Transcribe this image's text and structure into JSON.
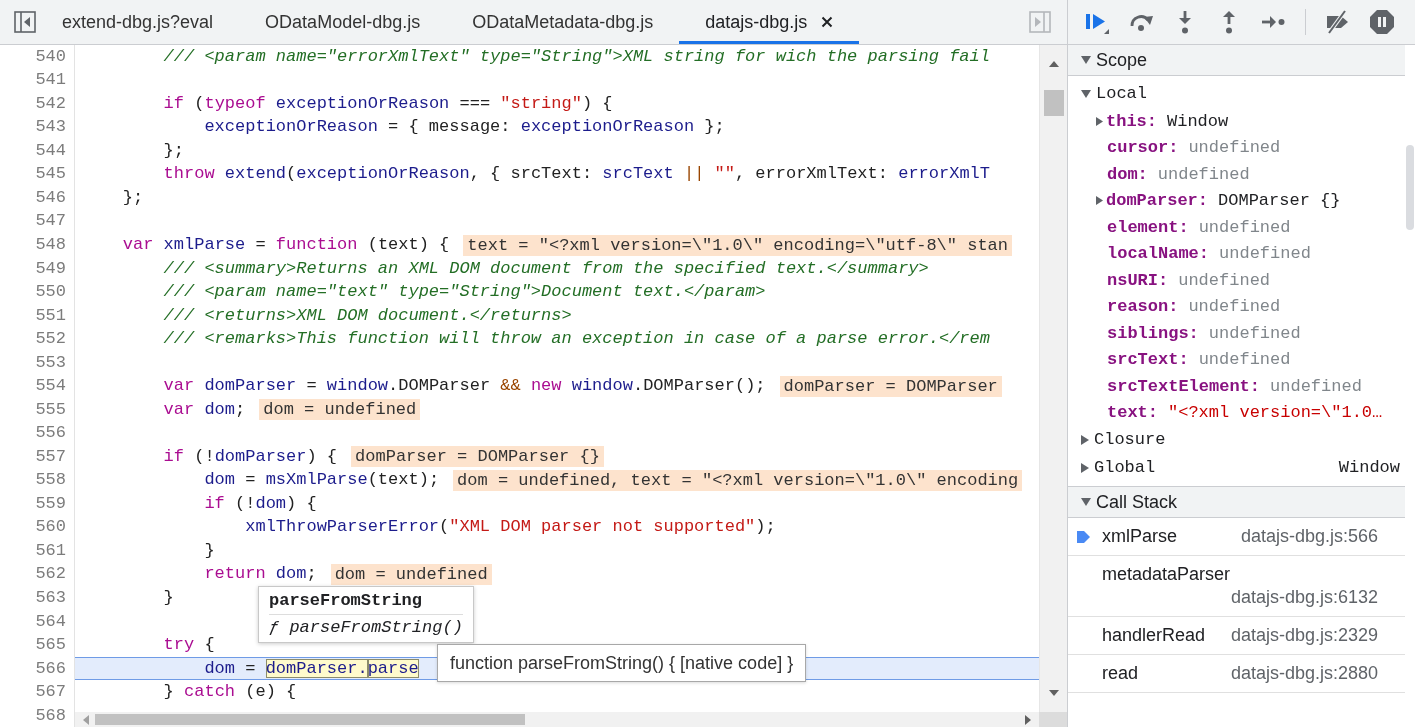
{
  "editor": {
    "tabs": [
      {
        "label": "extend-dbg.js?eval",
        "selected": false
      },
      {
        "label": "ODataModel-dbg.js",
        "selected": false
      },
      {
        "label": "ODataMetadata-dbg.js",
        "selected": false
      },
      {
        "label": "datajs-dbg.js",
        "selected": true
      }
    ],
    "lines": [
      {
        "number": "540",
        "current": false,
        "tokens": [
          {
            "kind": "comment",
            "text": "        /// <param name=\"errorXmlText\" type=\"String\">XML string for wich the parsing fail"
          }
        ]
      },
      {
        "number": "541",
        "current": false
      },
      {
        "number": "542",
        "current": false,
        "tokens": [
          {
            "kind": "keyword",
            "text": "        if"
          },
          {
            "kind": "plain",
            "text": " ("
          },
          {
            "kind": "keyword",
            "text": "typeof"
          },
          {
            "kind": "variable",
            "text": " exceptionOrReason"
          },
          {
            "kind": "plain",
            "text": " === "
          },
          {
            "kind": "string",
            "text": "\"string\""
          },
          {
            "kind": "plain",
            "text": ") {"
          }
        ]
      },
      {
        "number": "543",
        "current": false,
        "tokens": [
          {
            "kind": "variable",
            "text": "            exceptionOrReason"
          },
          {
            "kind": "plain",
            "text": " = { message: "
          },
          {
            "kind": "variable",
            "text": "exceptionOrReason"
          },
          {
            "kind": "plain",
            "text": " };"
          }
        ]
      },
      {
        "number": "544",
        "current": false,
        "tokens": [
          {
            "kind": "plain",
            "text": "        };"
          }
        ]
      },
      {
        "number": "545",
        "current": false,
        "tokens": [
          {
            "kind": "keyword",
            "text": "        throw"
          },
          {
            "kind": "variable",
            "text": " extend"
          },
          {
            "kind": "plain",
            "text": "("
          },
          {
            "kind": "variable",
            "text": "exceptionOrReason"
          },
          {
            "kind": "plain",
            "text": ", { srcText: "
          },
          {
            "kind": "variable",
            "text": "srcText"
          },
          {
            "kind": "operator",
            "text": " ||"
          },
          {
            "kind": "string",
            "text": " \"\""
          },
          {
            "kind": "plain",
            "text": ", errorXmlText: "
          },
          {
            "kind": "variable",
            "text": "errorXmlT"
          }
        ]
      },
      {
        "number": "546",
        "current": false,
        "tokens": [
          {
            "kind": "plain",
            "text": "    };"
          }
        ]
      },
      {
        "number": "547",
        "current": false
      },
      {
        "number": "548",
        "current": false,
        "tokens": [
          {
            "kind": "keyword",
            "text": "    var"
          },
          {
            "kind": "variable",
            "text": " xmlParse"
          },
          {
            "kind": "plain",
            "text": " = "
          },
          {
            "kind": "keyword",
            "text": "function"
          },
          {
            "kind": "plain",
            "text": " (text) {"
          }
        ],
        "inline_value": "text = \"<?xml version=\\\"1.0\\\" encoding=\\\"utf-8\\\" stan"
      },
      {
        "number": "549",
        "current": false,
        "tokens": [
          {
            "kind": "comment",
            "text": "        /// <summary>Returns an XML DOM document from the specified text.</summary>"
          }
        ]
      },
      {
        "number": "550",
        "current": false,
        "tokens": [
          {
            "kind": "comment",
            "text": "        /// <param name=\"text\" type=\"String\">Document text.</param>"
          }
        ]
      },
      {
        "number": "551",
        "current": false,
        "tokens": [
          {
            "kind": "comment",
            "text": "        /// <returns>XML DOM document.</returns>"
          }
        ]
      },
      {
        "number": "552",
        "current": false,
        "tokens": [
          {
            "kind": "comment",
            "text": "        /// <remarks>This function will throw an exception in case of a parse error.</rem"
          }
        ]
      },
      {
        "number": "553",
        "current": false
      },
      {
        "number": "554",
        "current": false,
        "tokens": [
          {
            "kind": "keyword",
            "text": "        var"
          },
          {
            "kind": "variable",
            "text": " domParser"
          },
          {
            "kind": "plain",
            "text": " = "
          },
          {
            "kind": "variable",
            "text": "window"
          },
          {
            "kind": "plain",
            "text": ".DOMParser "
          },
          {
            "kind": "operator",
            "text": "&&"
          },
          {
            "kind": "keyword",
            "text": " new"
          },
          {
            "kind": "variable",
            "text": " window"
          },
          {
            "kind": "plain",
            "text": ".DOMParser();"
          }
        ],
        "inline_value": "domParser = DOMParser"
      },
      {
        "number": "555",
        "current": false,
        "tokens": [
          {
            "kind": "keyword",
            "text": "        var"
          },
          {
            "kind": "variable",
            "text": " dom"
          },
          {
            "kind": "plain",
            "text": ";"
          }
        ],
        "inline_value": "dom = undefined"
      },
      {
        "number": "556",
        "current": false
      },
      {
        "number": "557",
        "current": false,
        "tokens": [
          {
            "kind": "keyword",
            "text": "        if"
          },
          {
            "kind": "plain",
            "text": " (!"
          },
          {
            "kind": "variable",
            "text": "domParser"
          },
          {
            "kind": "plain",
            "text": ") {"
          }
        ],
        "inline_value": "domParser = DOMParser {}"
      },
      {
        "number": "558",
        "current": false,
        "tokens": [
          {
            "kind": "variable",
            "text": "            dom"
          },
          {
            "kind": "plain",
            "text": " = "
          },
          {
            "kind": "variable",
            "text": "msXmlParse"
          },
          {
            "kind": "plain",
            "text": "(text);"
          }
        ],
        "inline_value": "dom = undefined, text = \"<?xml version=\\\"1.0\\\" encoding"
      },
      {
        "number": "559",
        "current": false,
        "tokens": [
          {
            "kind": "keyword",
            "text": "            if"
          },
          {
            "kind": "plain",
            "text": " (!"
          },
          {
            "kind": "variable",
            "text": "dom"
          },
          {
            "kind": "plain",
            "text": ") {"
          }
        ]
      },
      {
        "number": "560",
        "current": false,
        "tokens": [
          {
            "kind": "variable",
            "text": "                xmlThrowParserError"
          },
          {
            "kind": "plain",
            "text": "("
          },
          {
            "kind": "string",
            "text": "\"XML DOM parser not supported\""
          },
          {
            "kind": "plain",
            "text": ");"
          }
        ]
      },
      {
        "number": "561",
        "current": false,
        "tokens": [
          {
            "kind": "plain",
            "text": "            }"
          }
        ]
      },
      {
        "number": "562",
        "current": false,
        "tokens": [
          {
            "kind": "keyword",
            "text": "            return"
          },
          {
            "kind": "variable",
            "text": " dom"
          },
          {
            "kind": "plain",
            "text": ";"
          }
        ],
        "inline_value": "dom = undefined"
      },
      {
        "number": "563",
        "current": false,
        "tokens": [
          {
            "kind": "plain",
            "text": "        }"
          }
        ]
      },
      {
        "number": "564",
        "current": false
      },
      {
        "number": "565",
        "current": false,
        "tokens": [
          {
            "kind": "keyword",
            "text": "        try"
          },
          {
            "kind": "plain",
            "text": " {"
          }
        ]
      },
      {
        "number": "566",
        "current": true,
        "tokens": [
          {
            "kind": "variable",
            "text": "            dom"
          },
          {
            "kind": "plain",
            "text": " = "
          },
          {
            "kind": "hovered",
            "text": "domParser."
          },
          {
            "kind": "hovered",
            "text": "parse"
          }
        ]
      },
      {
        "number": "567",
        "current": false,
        "tokens": [
          {
            "kind": "plain",
            "text": "        } "
          },
          {
            "kind": "keyword",
            "text": "catch"
          },
          {
            "kind": "plain",
            "text": " (e) {"
          }
        ]
      },
      {
        "number": "568",
        "current": false
      }
    ],
    "hover_popup": {
      "title": "parseFromString",
      "signature": "ƒ parseFromString()"
    },
    "tooltip": "function parseFromString() { [native code] }"
  },
  "debugger": {
    "scope": {
      "title": "Scope",
      "expanded": true,
      "groups": [
        {
          "name": "Local",
          "expanded": true,
          "variables": [
            {
              "name": "this:",
              "value": "Window",
              "kind": "object",
              "expanded": false
            },
            {
              "name": "cursor:",
              "value": "undefined",
              "kind": "undefined"
            },
            {
              "name": "dom:",
              "value": "undefined",
              "kind": "undefined"
            },
            {
              "name": "domParser:",
              "value": "DOMParser {}",
              "kind": "object",
              "expanded": false
            },
            {
              "name": "element:",
              "value": "undefined",
              "kind": "undefined"
            },
            {
              "name": "localName:",
              "value": "undefined",
              "kind": "undefined"
            },
            {
              "name": "nsURI:",
              "value": "undefined",
              "kind": "undefined"
            },
            {
              "name": "reason:",
              "value": "undefined",
              "kind": "undefined"
            },
            {
              "name": "siblings:",
              "value": "undefined",
              "kind": "undefined"
            },
            {
              "name": "srcText:",
              "value": "undefined",
              "kind": "undefined"
            },
            {
              "name": "srcTextElement:",
              "value": "undefined",
              "kind": "undefined"
            },
            {
              "name": "text:",
              "value": "\"<?xml version=\\\"1.0…",
              "kind": "string"
            }
          ]
        },
        {
          "name": "Closure",
          "expanded": false
        },
        {
          "name": "Global",
          "expanded": false,
          "value": "Window"
        }
      ]
    },
    "call_stack": {
      "title": "Call Stack",
      "expanded": true,
      "frames": [
        {
          "function": "xmlParse",
          "location": "datajs-dbg.js:566",
          "selected": true
        },
        {
          "function": "metadataParser",
          "location": "datajs-dbg.js:6132",
          "selected": false
        },
        {
          "function": "handlerRead",
          "location": "datajs-dbg.js:2329",
          "selected": false
        },
        {
          "function": "read",
          "location": "datajs-dbg.js:2880",
          "selected": false
        }
      ]
    }
  }
}
